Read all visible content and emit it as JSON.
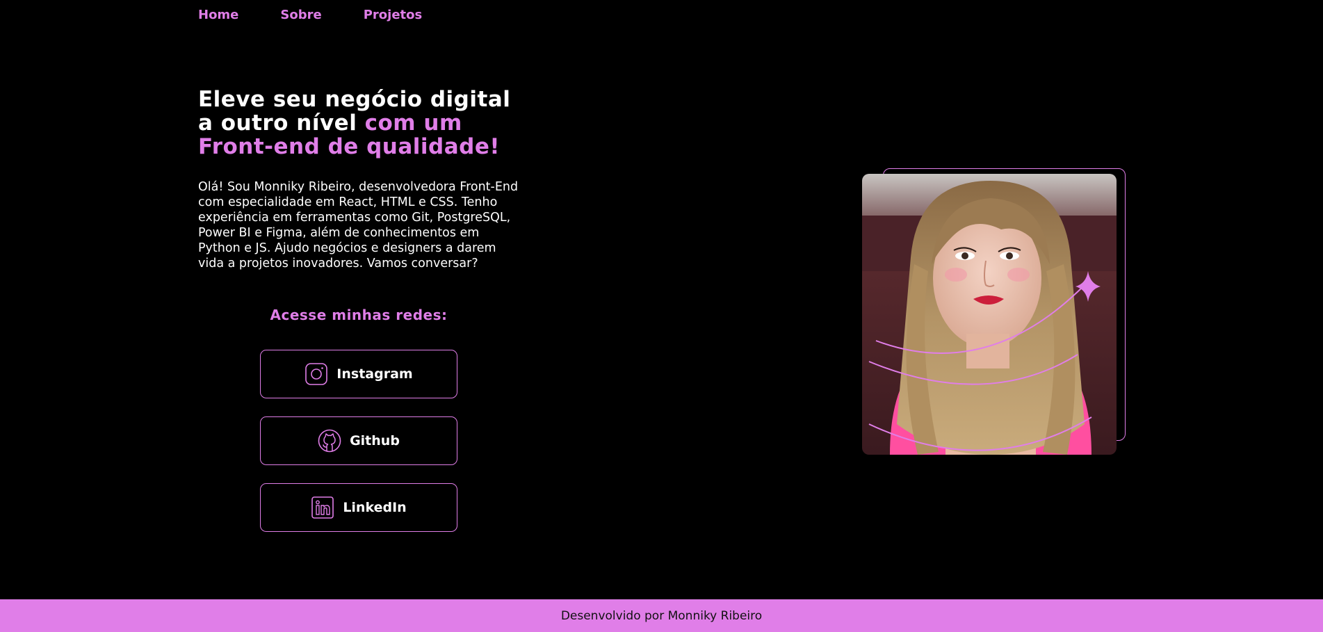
{
  "nav": {
    "items": [
      {
        "label": "Home"
      },
      {
        "label": "Sobre"
      },
      {
        "label": "Projetos"
      }
    ]
  },
  "hero": {
    "title_line1": "Eleve seu negócio digital",
    "title_line2_white": "a outro nível ",
    "title_line2_accent": "com um",
    "title_line3_accent": "Front-end de qualidade!",
    "text": "Olá! Sou Monniky Ribeiro, desenvolvedora Front-End com especialidade em React, HTML e CSS. Tenho experiência em ferramentas como Git, PostgreSQL, Power BI e Figma, além de conhecimentos em Python e JS. Ajudo negócios e designers a darem vida a projetos inovadores. Vamos conversar?"
  },
  "networks": {
    "title": "Acesse minhas redes:",
    "buttons": [
      {
        "label": "Instagram",
        "icon": "instagram-icon"
      },
      {
        "label": "Github",
        "icon": "github-icon"
      },
      {
        "label": "LinkedIn",
        "icon": "linkedin-icon"
      }
    ]
  },
  "footer": {
    "text": "Desenvolvido por Monniky Ribeiro"
  },
  "colors": {
    "accent": "#e07ee8",
    "background": "#000000",
    "text": "#ffffff"
  }
}
